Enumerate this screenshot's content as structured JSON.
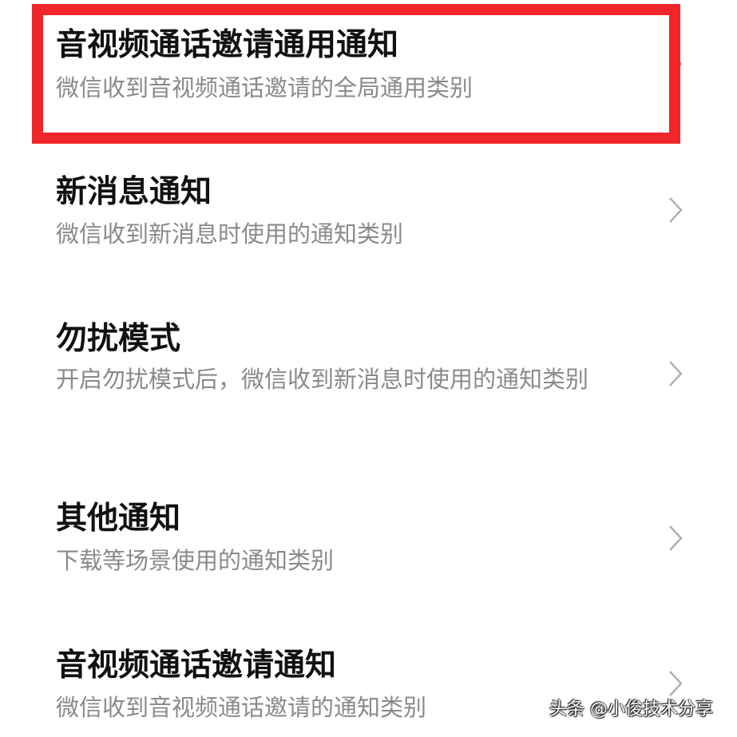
{
  "items": [
    {
      "title": "音视频通话邀请通用通知",
      "description": "微信收到音视频通话邀请的全局通用类别",
      "chevron_icon": "chevron-right-icon"
    },
    {
      "title": "新消息通知",
      "description": "微信收到新消息时使用的通知类别",
      "chevron_icon": "chevron-right-icon"
    },
    {
      "title": "勿扰模式",
      "description": "开启勿扰模式后，微信收到新消息时使用的通知类别",
      "chevron_icon": "chevron-right-icon"
    },
    {
      "title": "其他通知",
      "description": "下载等场景使用的通知类别",
      "chevron_icon": "chevron-right-icon"
    },
    {
      "title": "音视频通话邀请通知",
      "description": "微信收到音视频通话邀请的通知类别",
      "chevron_icon": "chevron-right-icon"
    }
  ],
  "highlight": {
    "color": "#f0262a"
  },
  "watermark": {
    "text": "头条 @小俊技术分享"
  },
  "colors": {
    "title": "#111111",
    "description": "#8a8a8a",
    "chevron": "#b0b0b0",
    "background": "#ffffff"
  }
}
